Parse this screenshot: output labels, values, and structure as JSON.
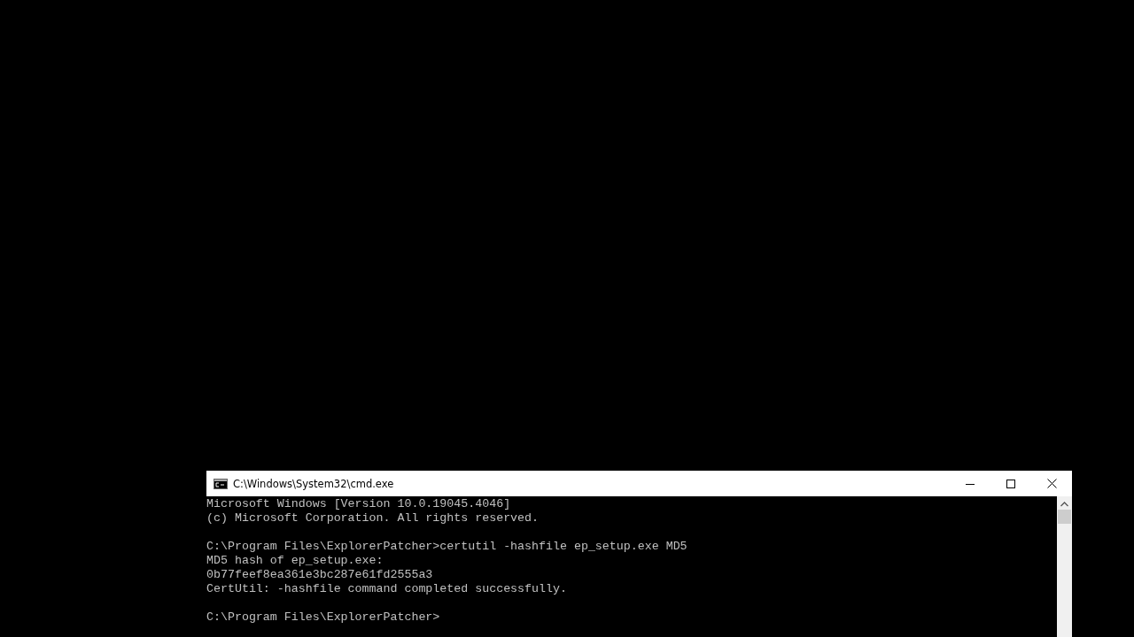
{
  "window": {
    "title": "C:\\Windows\\System32\\cmd.exe"
  },
  "console": {
    "blocks": [
      [
        "Microsoft Windows [Version 10.0.19045.4046]",
        "(c) Microsoft Corporation. All rights reserved."
      ],
      [
        "C:\\Program Files\\ExplorerPatcher>certutil -hashfile ep_setup.exe MD5",
        "MD5 hash of ep_setup.exe:",
        "0b77feef8ea361e3bc287e61fd2555a3",
        "CertUtil: -hashfile command completed successfully."
      ],
      [
        "C:\\Program Files\\ExplorerPatcher>"
      ]
    ]
  }
}
